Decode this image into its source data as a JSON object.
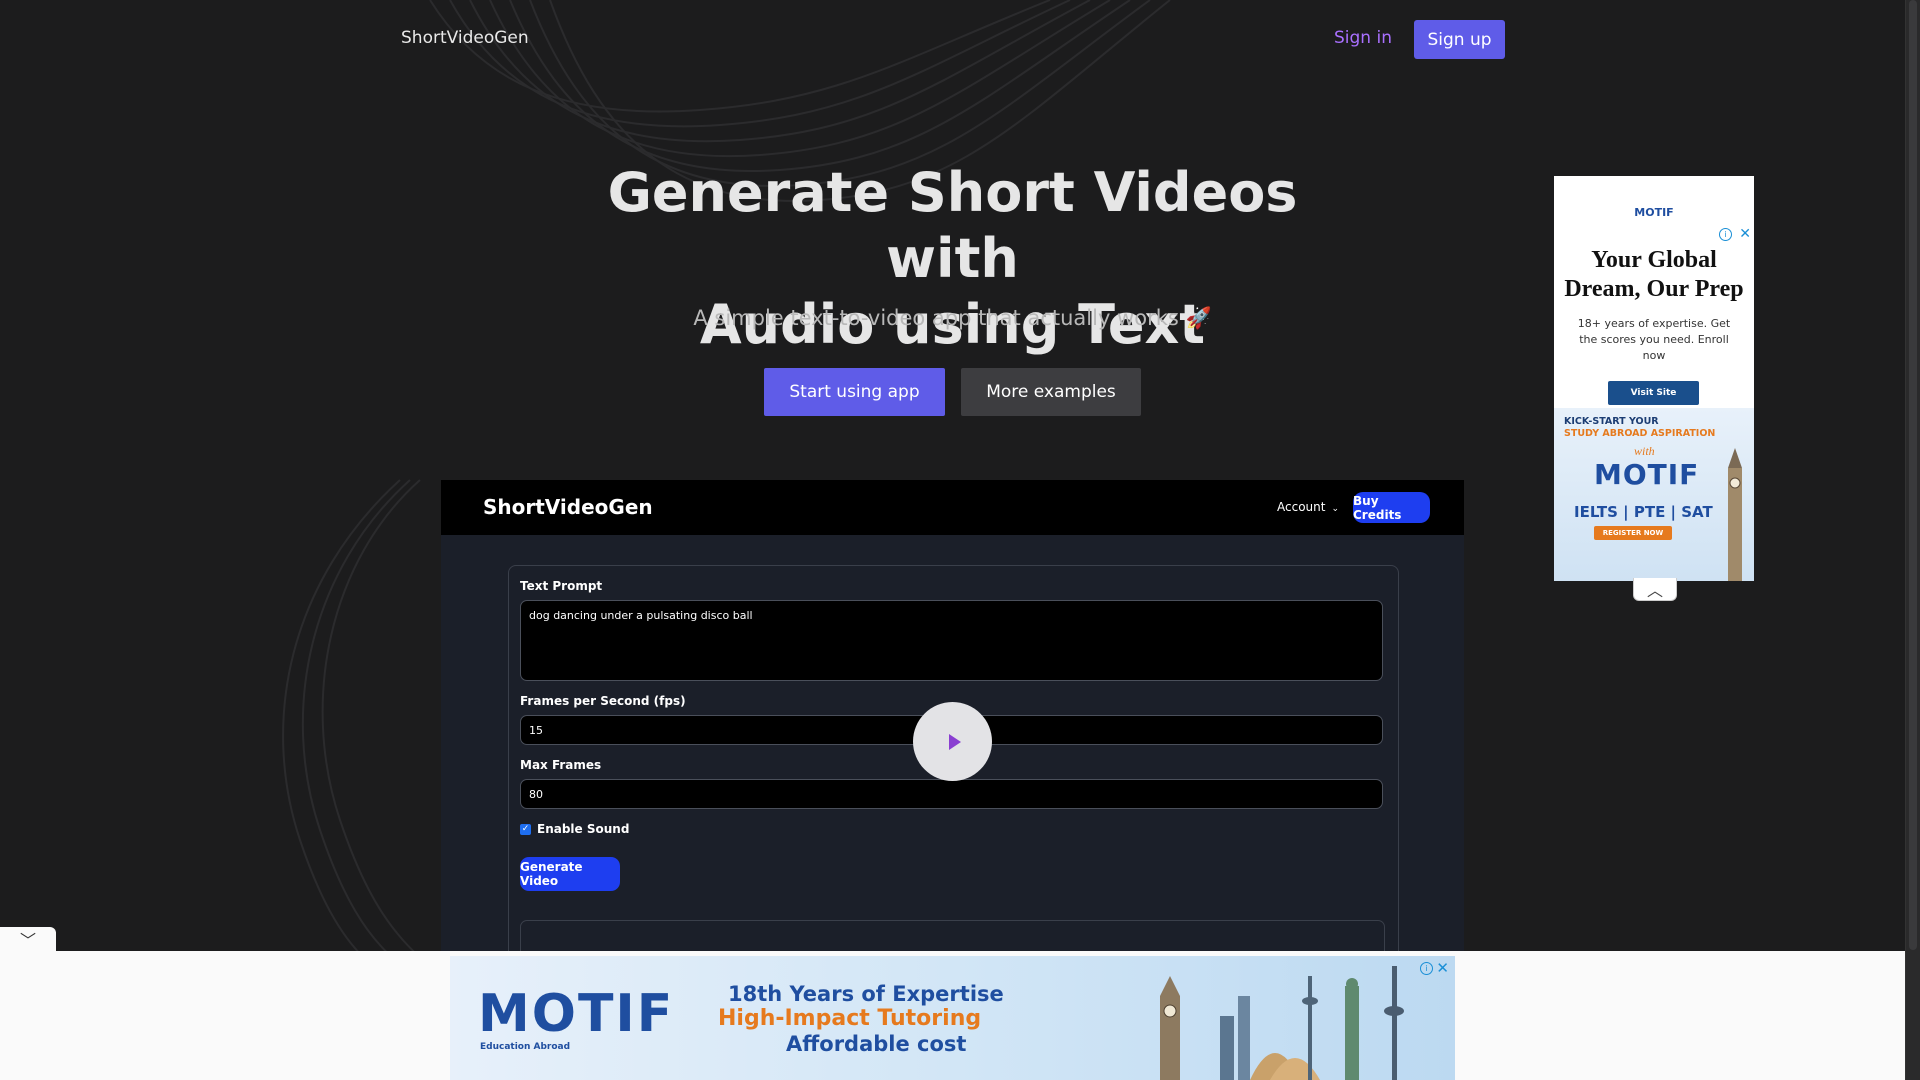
{
  "nav": {
    "brand": "ShortVideoGen",
    "sign_in": "Sign in",
    "sign_up": "Sign up"
  },
  "hero": {
    "title_line1": "Generate Short Videos with",
    "title_line2": "Audio using Text",
    "subtitle": "A simple text-to-video app that actually works 🚀",
    "primary_button": "Start using app",
    "secondary_button": "More examples"
  },
  "app_preview": {
    "brand": "ShortVideoGen",
    "account_label": "Account",
    "buy_credits": "Buy Credits",
    "form": {
      "prompt_label": "Text Prompt",
      "prompt_value": "dog dancing under a pulsating disco ball",
      "fps_label": "Frames per Second (fps)",
      "fps_value": "15",
      "max_frames_label": "Max Frames",
      "max_frames_value": "80",
      "sound_label": "Enable Sound",
      "sound_enabled": true,
      "generate_button": "Generate Video"
    }
  },
  "side_ad": {
    "logo": "MOTIF",
    "headline_line1": "Your Global",
    "headline_line2": "Dream, Our Prep",
    "text": "18+ years of expertise. Get the scores you need. Enroll now",
    "visit_button": "Visit Site",
    "kick_line1": "KICK-START YOUR",
    "kick_line2": "STUDY ABROAD ASPIRATION",
    "with": "with",
    "brand": "MOTIF",
    "tests": "IELTS | PTE | SAT",
    "register_button": "REGISTER NOW"
  },
  "bottom_ad": {
    "brand": "MOTIF",
    "brand_sub": "Education Abroad",
    "line1": "18th Years of Expertise",
    "line2": "High-Impact Tutoring",
    "line3": "Affordable cost"
  },
  "colors": {
    "background": "#1c1c1d",
    "accent": "#5f5ce8",
    "sign_in": "#a970ff",
    "app_button": "#1e3ef0",
    "ad_blue": "#1f4ea0",
    "ad_orange": "#e67a1e"
  },
  "icons": {
    "play": "play-icon",
    "account_chevron": "chevron-down-icon",
    "ad_close": "close-icon",
    "ad_info": "info-icon",
    "ad_collapse": "chevron-up-icon",
    "bottom_toggle": "chevron-down-icon"
  }
}
